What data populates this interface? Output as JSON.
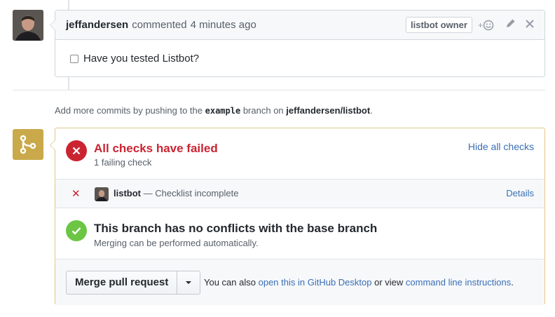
{
  "comment": {
    "author": "jeffandersen",
    "action": "commented",
    "time": "4 minutes ago",
    "badge": "listbot owner",
    "reaction_plus": "+",
    "body": "Have you tested Listbot?"
  },
  "info": {
    "prefix": "Add more commits by pushing to the",
    "branch": "example",
    "middle": "branch on",
    "repo": "jeffandersen/listbot",
    "suffix": "."
  },
  "checks": {
    "title": "All checks have failed",
    "subtitle": "1 failing check",
    "toggle_label": "Hide all checks",
    "items": [
      {
        "name": "listbot",
        "description": "— Checklist incomplete",
        "details_label": "Details"
      }
    ]
  },
  "conflicts": {
    "title": "This branch has no conflicts with the base branch",
    "subtitle": "Merging can be performed automatically."
  },
  "merge": {
    "button_label": "Merge pull request",
    "note_prefix": "You can also",
    "desktop_link": "open this in GitHub Desktop",
    "note_middle": "or view",
    "cli_link": "command line instructions",
    "note_suffix": "."
  },
  "colors": {
    "fail": "#cb2431",
    "success": "#6cc644",
    "merge_icon_bg": "#c9a94a",
    "link": "#3b6fb6"
  }
}
